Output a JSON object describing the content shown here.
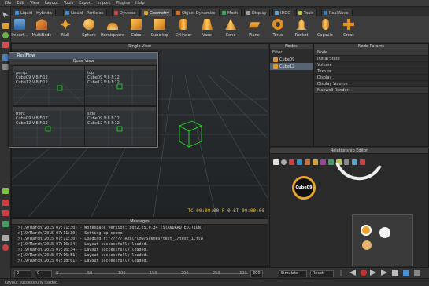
{
  "menubar": [
    "File",
    "Edit",
    "View",
    "Layout",
    "Tools",
    "Export",
    "Import",
    "Plugins",
    "Help"
  ],
  "tabs": [
    {
      "label": "Liquid - Hybrido",
      "color": "#3a8fd9"
    },
    {
      "label": "Liquid - Particles",
      "color": "#3a8fd9"
    },
    {
      "label": "Dyverso",
      "color": "#d04040"
    },
    {
      "label": "Geometry",
      "color": "#e0a030"
    },
    {
      "label": "Object Dynamics",
      "color": "#d07030"
    },
    {
      "label": "Mesh",
      "color": "#40a060"
    },
    {
      "label": "Display",
      "color": "#a0a0a0"
    },
    {
      "label": "IDOC",
      "color": "#60a0d0"
    },
    {
      "label": "Tools",
      "color": "#c0c040"
    },
    {
      "label": "RealWave",
      "color": "#3080c0"
    }
  ],
  "active_tab": "Geometry",
  "shelf": [
    "Import...",
    "MultiBody",
    "Null",
    "Sphere",
    "Hemisphere",
    "Cube",
    "Cube top",
    "Cylinder",
    "Vase",
    "Cone",
    "Plane",
    "Torus",
    "Rocket",
    "Capsule",
    "Cross"
  ],
  "viewport": {
    "title": "Single View",
    "status": "TC 00:00:00    F 0    ST 00:00:00"
  },
  "realflow_window": {
    "title": "RealFlow",
    "subtitle": "Quad View",
    "quads": [
      {
        "view": "persp",
        "lines": [
          "Cube09 V:8 F:12",
          "Cube12 V:8 F:12"
        ]
      },
      {
        "view": "top",
        "lines": [
          "Cube09 V:8 F:12",
          "Cube12 V:8 F:12"
        ]
      },
      {
        "view": "front",
        "lines": [
          "Cube09 V:8 F:12",
          "Cube12 V:8 F:12"
        ]
      },
      {
        "view": "side",
        "lines": [
          "Cube09 V:8 F:12",
          "Cube12 V:8 F:12"
        ]
      }
    ]
  },
  "nodes_panel": {
    "title": "Nodes",
    "filter": "Filter",
    "items": [
      "Cube09",
      "Cube12"
    ],
    "selected": "Cube12"
  },
  "node_params": {
    "title": "Node Params",
    "rows": [
      "Node",
      "Initial State",
      "Volume",
      "Texture",
      "Display",
      "Display Volume",
      "Maxwell Render"
    ]
  },
  "relationship_editor": {
    "title": "Relationship Editor",
    "node_label": "Cube09"
  },
  "messages": {
    "title": "Messages",
    "lines": [
      ">[19/March/2015 07:11:30] - Workspace version: 8022.25.0.34 (STANDARD EDITION)",
      ">[19/March/2015 07:11:30] - Setting up scene",
      ">[19/March/2015 07:11:30] - Loading F:/????/ RealFlow/Scenes/test_1/test_1.flw",
      ">[19/March/2015 07:16:34] - Layout successfully loaded.",
      ">[19/March/2015 07:16:34] - Layout successfully loaded.",
      ">[19/March/2015 07:16:51] - Layout successfully loaded.",
      ">[19/March/2015 07:18:01] - Layout successfully loaded."
    ]
  },
  "timeline": {
    "start": "0",
    "current": "0",
    "ticks": [
      "0",
      "50",
      "100",
      "150",
      "200",
      "250",
      "300"
    ],
    "end_field": "300",
    "end_field2": "300",
    "simulate": "Simulate",
    "reset": "Reset"
  },
  "statusbar": "Layout successfully loaded."
}
